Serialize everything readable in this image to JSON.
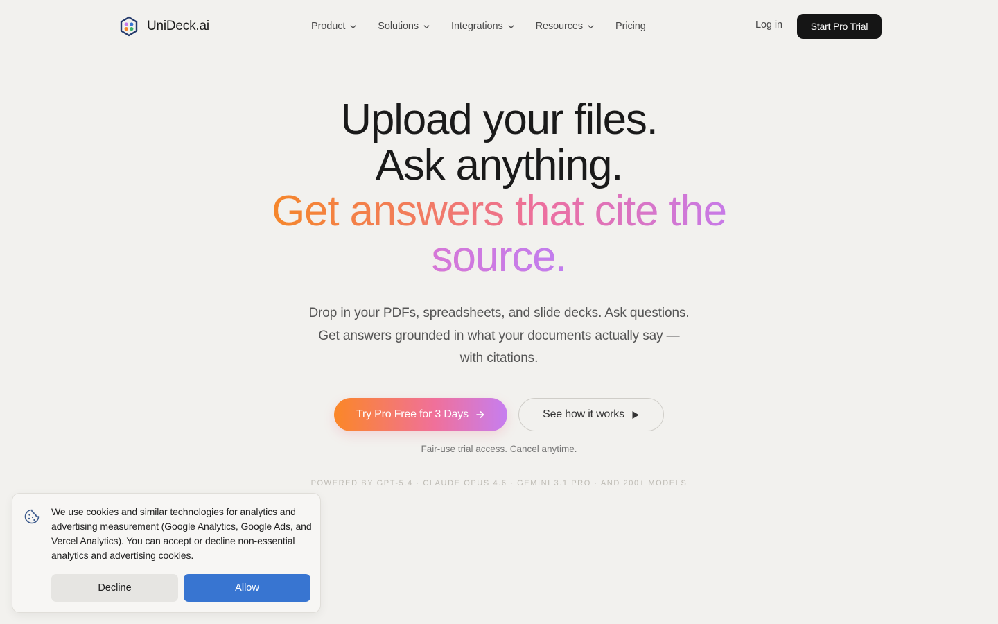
{
  "brand": {
    "name": "UniDeck.ai",
    "logo_icon": "hexagon-dots-logo"
  },
  "nav": {
    "items": [
      {
        "label": "Product",
        "has_dropdown": true
      },
      {
        "label": "Solutions",
        "has_dropdown": true
      },
      {
        "label": "Integrations",
        "has_dropdown": true
      },
      {
        "label": "Resources",
        "has_dropdown": true
      },
      {
        "label": "Pricing",
        "has_dropdown": false
      }
    ],
    "login_label": "Log in",
    "cta_label": "Start Pro Trial"
  },
  "hero": {
    "line1": "Upload your files.",
    "line2": "Ask anything.",
    "gradient_line_a": "Get answers that cite the",
    "gradient_line_b": "source.",
    "subtitle_1": "Drop in your PDFs, spreadsheets, and slide decks. Ask questions.",
    "subtitle_2": "Get answers grounded in what your documents actually say —",
    "subtitle_3": "with citations.",
    "primary_cta": "Try Pro Free for 3 Days",
    "secondary_cta": "See how it works",
    "fine_print": "Fair-use trial access. Cancel anytime.",
    "powered_by": "POWERED BY GPT-5.4 · CLAUDE OPUS 4.6 · GEMINI 3.1 PRO · AND 200+ MODELS",
    "gradient_colors": [
      "#f5862a",
      "#ec6fa0",
      "#c77ae8"
    ]
  },
  "cookie_banner": {
    "icon": "cookie-icon",
    "text": "We use cookies and similar technologies for analytics and advertising measurement (Google Analytics, Google Ads, and Vercel Analytics). You can accept or decline non-essential analytics and advertising cookies.",
    "decline_label": "Decline",
    "allow_label": "Allow",
    "allow_color": "#3875d1"
  },
  "colors": {
    "background": "#f2f1ee",
    "cta_dark": "#151515"
  }
}
